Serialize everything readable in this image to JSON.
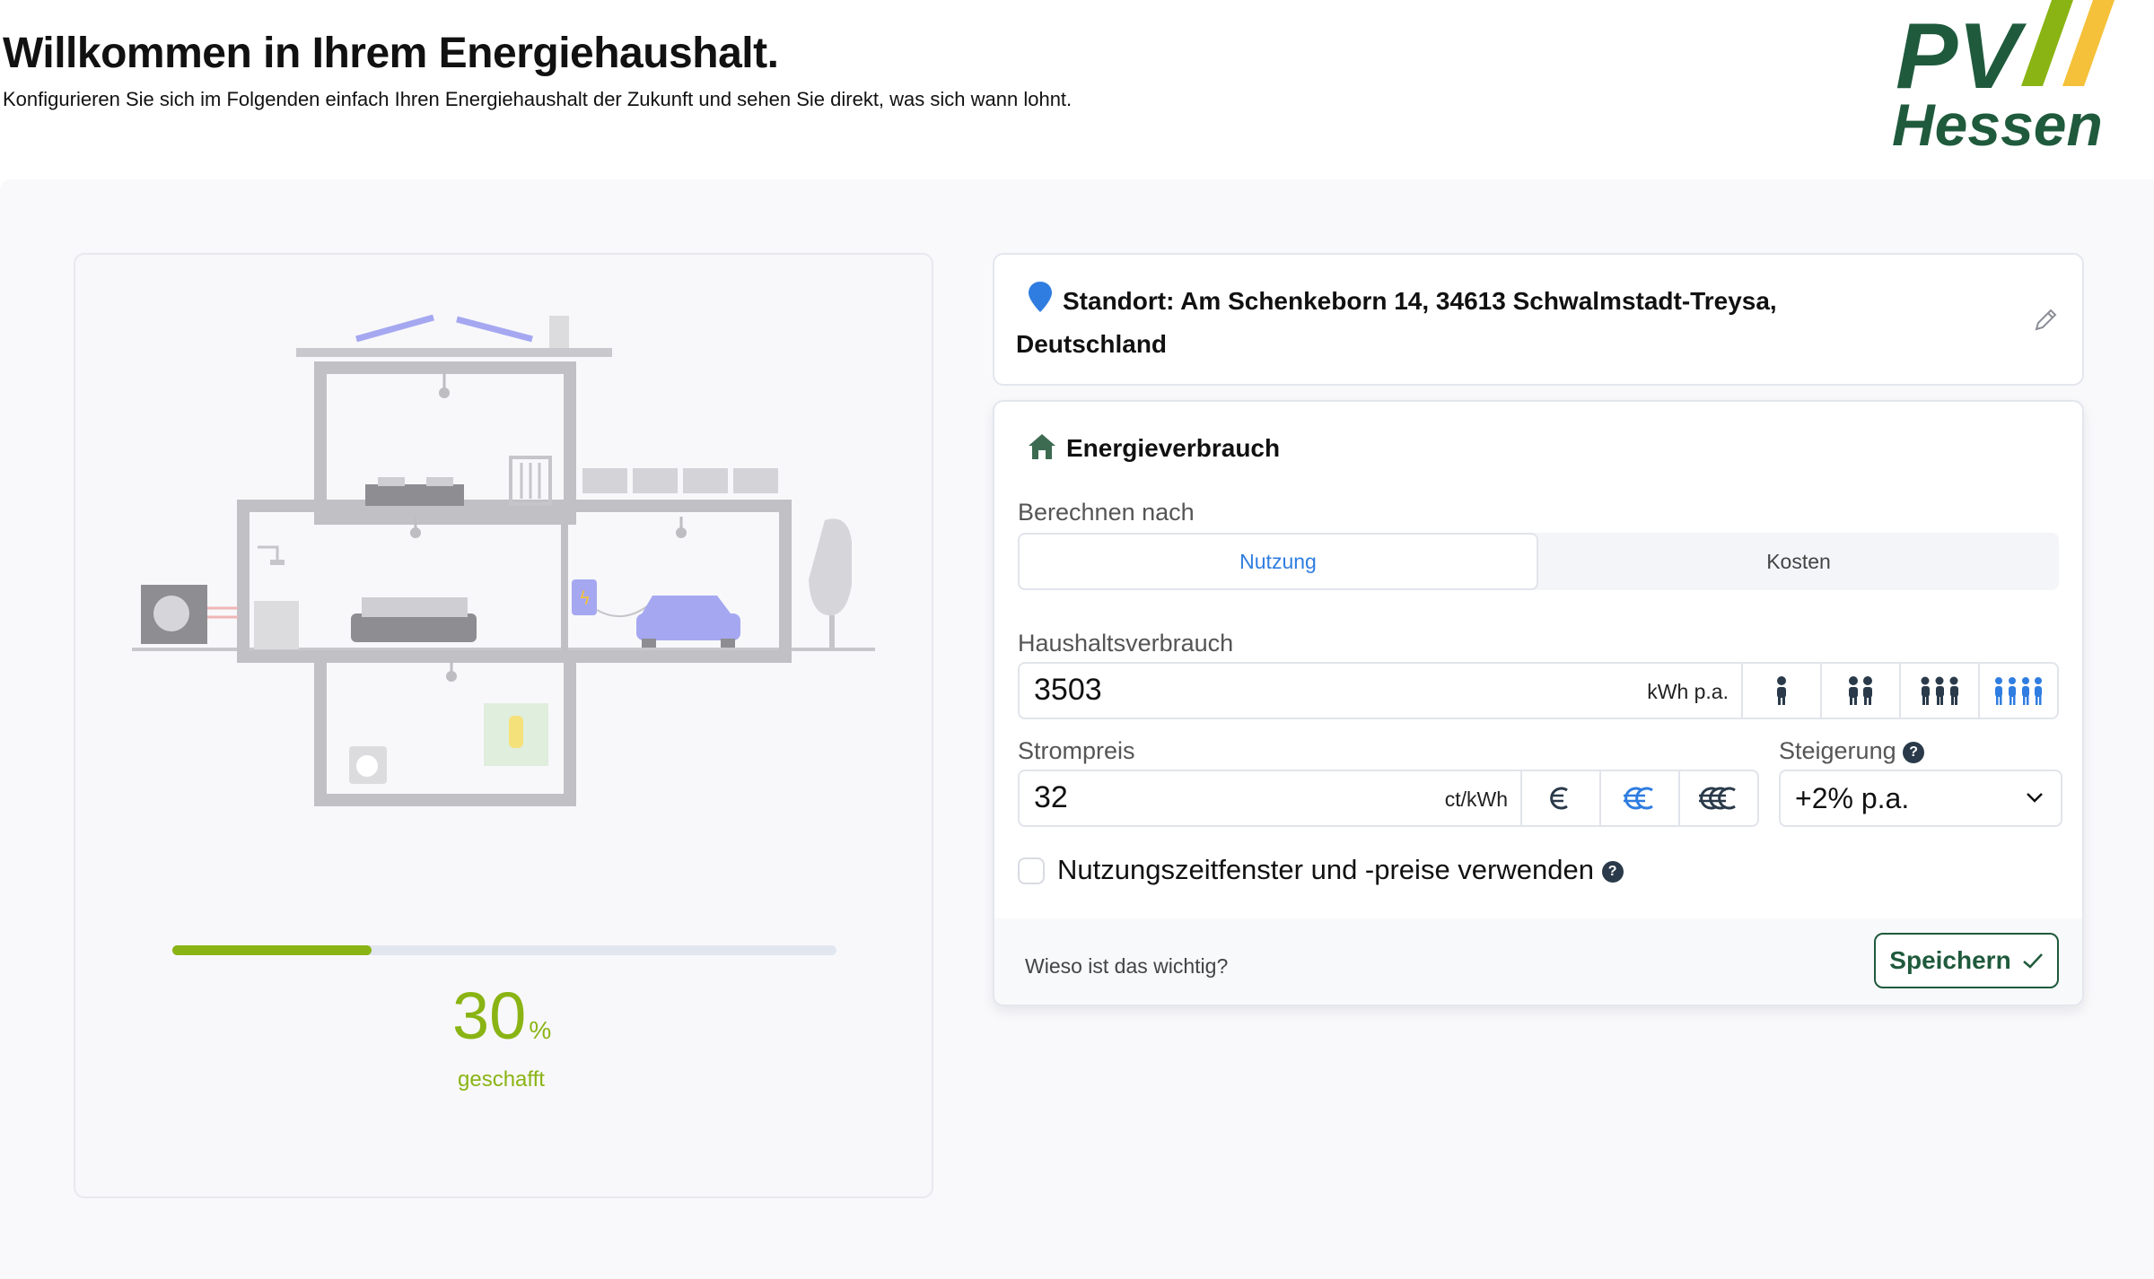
{
  "header": {
    "title": "Willkommen in Ihrem Energiehaushalt.",
    "subtitle": "Konfigurieren Sie sich im Folgenden einfach Ihren Energiehaushalt der Zukunft und sehen Sie direkt, was sich wann lohnt.",
    "logo_line1": "PV",
    "logo_line2": "Hessen"
  },
  "progress": {
    "value": "30",
    "unit": "%",
    "fraction": 0.3,
    "label": "geschafft"
  },
  "location": {
    "text": "Standort: Am Schenkeborn 14, 34613 Schwalmstadt-Treysa, Deutschland"
  },
  "energy": {
    "title": "Energieverbrauch",
    "calc_label": "Berechnen nach",
    "tabs": [
      {
        "label": "Nutzung",
        "active": true
      },
      {
        "label": "Kosten",
        "active": false
      }
    ],
    "consumption": {
      "label": "Haushaltsverbrauch",
      "value": "3503",
      "unit": "kWh p.a.",
      "household_icons": [
        "person-1-icon",
        "person-2-icon",
        "person-3-icon",
        "person-4-icon"
      ],
      "selected_household": 4
    },
    "price": {
      "label": "Strompreis",
      "value": "32",
      "unit": "ct/kWh",
      "price_icons": [
        "euro-1-icon",
        "euro-2-icon",
        "euro-3-icon"
      ],
      "selected_price": 2
    },
    "increase": {
      "label": "Steigerung",
      "value": "+2% p.a."
    },
    "time_window": {
      "label": "Nutzungszeitfenster und -preise verwenden",
      "checked": false
    },
    "footer": {
      "why_link": "Wieso ist das wichtig?",
      "save_label": "Speichern"
    }
  },
  "colors": {
    "accent_green": "#8ab414",
    "accent_blue": "#2f7de0",
    "brand_dark_green": "#1f5a3c",
    "brand_yellow": "#f5c13a"
  }
}
